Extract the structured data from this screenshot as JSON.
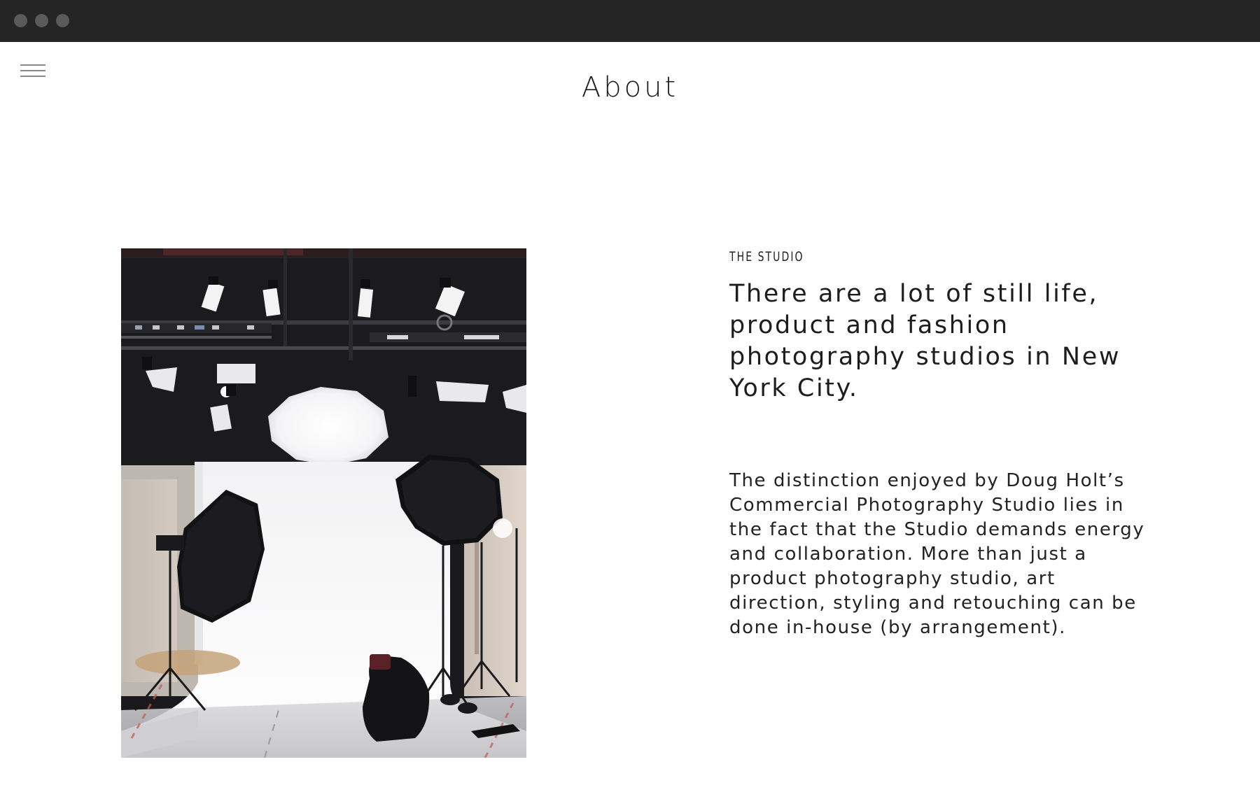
{
  "page": {
    "title": "About"
  },
  "nav": {
    "menu_icon": "hamburger-menu-icon"
  },
  "studio": {
    "label": "THE STUDIO",
    "headline": "There are a lot of still life, product and fashion photography studios in New York City.",
    "body": "The distinction enjoyed by Doug Holt’s Commercial Photography Studio lies in the fact that the Studio demands energy and collaboration. More than just a product photography studio, art direction, styling and retouching can be done in-house (by arrangement)."
  },
  "colors": {
    "chrome": "#252525",
    "traffic_light": "#5a5a5a",
    "text": "#1d1d1d",
    "menu_lines": "#8a8a8a"
  }
}
